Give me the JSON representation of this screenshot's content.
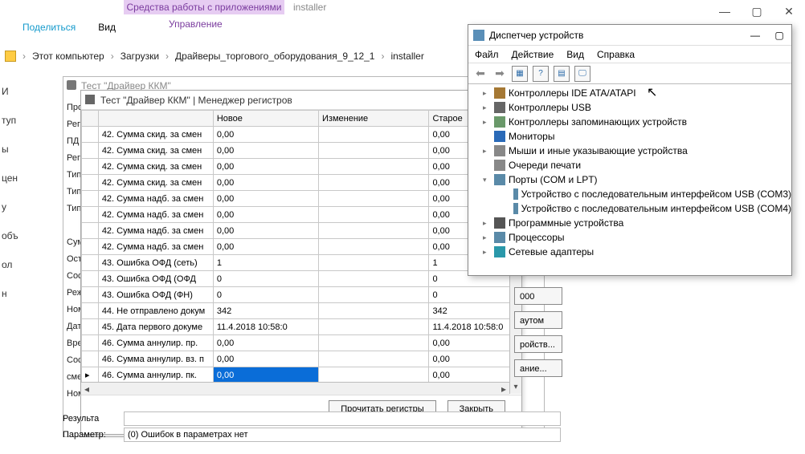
{
  "explorer": {
    "ribbon_tab": "Средства работы с приложениями",
    "title": "installer",
    "share": "Поделиться",
    "view": "Вид",
    "manage": "Управление",
    "breadcrumb": [
      "Этот компьютер",
      "Загрузки",
      "Драйверы_торгового_оборудования_9_12_1",
      "installer"
    ]
  },
  "left_hints": [
    "И",
    "туп",
    "ы",
    "цен",
    "у",
    "объ",
    "ол",
    "н"
  ],
  "kkm": {
    "title": "Тест \"Драйвер ККМ\"",
    "labels": [
      "Прогр",
      "Регист",
      "ПД",
      "Регист",
      "Тип опл",
      "Тип чек",
      "Тип опер",
      "",
      "Сумма:",
      "Остаток",
      "Состоян",
      "Режим/",
      "Номер ч",
      "Дата:",
      "Время:",
      "Состоян",
      "смены:",
      "Номер р"
    ]
  },
  "regmgr": {
    "title": "Тест \"Драйвер ККМ\" | Менеджер регистров",
    "headers": [
      "",
      "",
      "Новое",
      "Изменение",
      "Старое"
    ],
    "rows": [
      {
        "name": "42. Сумма скид. за смен",
        "new": "0,00",
        "chg": "",
        "old": "0,00"
      },
      {
        "name": "42. Сумма скид. за смен",
        "new": "0,00",
        "chg": "",
        "old": "0,00"
      },
      {
        "name": "42. Сумма скид. за смен",
        "new": "0,00",
        "chg": "",
        "old": "0,00"
      },
      {
        "name": "42. Сумма скид. за смен",
        "new": "0,00",
        "chg": "",
        "old": "0,00"
      },
      {
        "name": "42. Сумма надб. за смен",
        "new": "0,00",
        "chg": "",
        "old": "0,00"
      },
      {
        "name": "42. Сумма надб. за смен",
        "new": "0,00",
        "chg": "",
        "old": "0,00"
      },
      {
        "name": "42. Сумма надб. за смен",
        "new": "0,00",
        "chg": "",
        "old": "0,00"
      },
      {
        "name": "42. Сумма надб. за смен",
        "new": "0,00",
        "chg": "",
        "old": "0,00"
      },
      {
        "name": "43. Ошибка ОФД (сеть)",
        "new": "1",
        "chg": "",
        "old": "1"
      },
      {
        "name": "43. Ошибка ОФД (ОФД",
        "new": "0",
        "chg": "",
        "old": "0"
      },
      {
        "name": "43. Ошибка ОФД (ФН)",
        "new": "0",
        "chg": "",
        "old": "0"
      },
      {
        "name": "44. Не отправлено докум",
        "new": "342",
        "chg": "",
        "old": "342"
      },
      {
        "name": "45. Дата первого докуме",
        "new": "11.4.2018 10:58:0",
        "chg": "",
        "old": "11.4.2018 10:58:0"
      },
      {
        "name": "46. Сумма аннулир. пр. ",
        "new": "0,00",
        "chg": "",
        "old": "0,00"
      },
      {
        "name": "46. Сумма аннулир. вз. п",
        "new": "0,00",
        "chg": "",
        "old": "0,00"
      },
      {
        "name": "46. Сумма аннулир. пк. ",
        "new": "0,00",
        "chg": "",
        "old": "0,00",
        "selected": true
      }
    ],
    "btn_read": "Прочитать регистры",
    "btn_close": "Закрыть"
  },
  "side_btns": {
    "b1": "000",
    "b2": "аутом",
    "b3": "ройств...",
    "b4": "ание..."
  },
  "bottom": {
    "result_lbl": "Результа",
    "param_lbl": "Параметр:",
    "param_val": "(0) Ошибок в параметрах нет"
  },
  "devmgr": {
    "title": "Диспетчер устройств",
    "menu": [
      "Файл",
      "Действие",
      "Вид",
      "Справка"
    ],
    "tree": [
      {
        "exp": "▸",
        "icon": "di-ide",
        "label": "Контроллеры IDE ATA/ATAPI"
      },
      {
        "exp": "▸",
        "icon": "di-usb",
        "label": "Контроллеры USB"
      },
      {
        "exp": "▸",
        "icon": "di-mem",
        "label": "Контроллеры запоминающих устройств"
      },
      {
        "exp": "",
        "icon": "di-mon",
        "label": "Мониторы"
      },
      {
        "exp": "▸",
        "icon": "di-mouse",
        "label": "Мыши и иные указывающие устройства"
      },
      {
        "exp": "",
        "icon": "di-queue",
        "label": "Очереди печати"
      },
      {
        "exp": "▾",
        "icon": "di-port",
        "label": "Порты (COM и LPT)"
      },
      {
        "child": true,
        "icon": "di-port",
        "label": "Устройство с последовательным интерфейсом USB (COM3)"
      },
      {
        "child": true,
        "icon": "di-port",
        "label": "Устройство с последовательным интерфейсом USB (COM4)"
      },
      {
        "exp": "▸",
        "icon": "di-prog",
        "label": "Программные устройства"
      },
      {
        "exp": "▸",
        "icon": "di-cpu",
        "label": "Процессоры"
      },
      {
        "exp": "▸",
        "icon": "di-net",
        "label": "Сетевые адаптеры"
      }
    ]
  }
}
